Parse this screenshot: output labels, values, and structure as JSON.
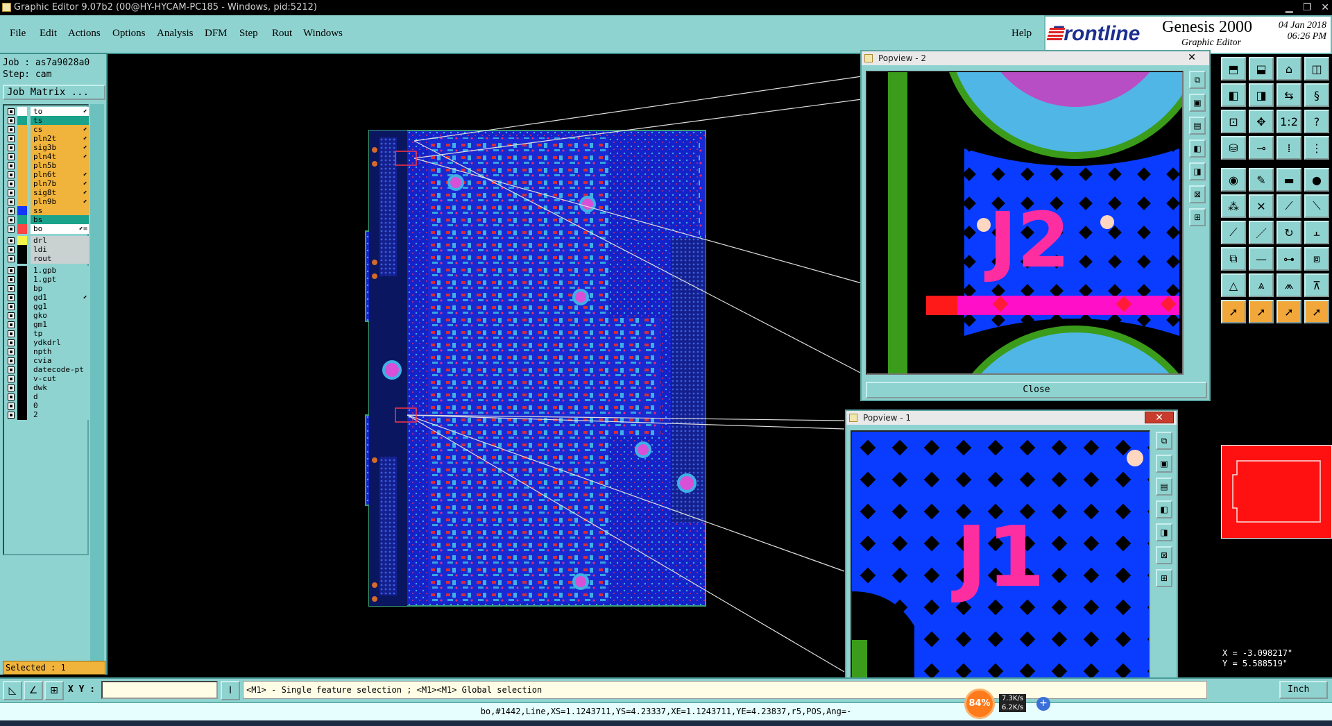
{
  "titlebar": {
    "title": "Graphic Editor 9.07b2 (00@HY-HYCAM-PC185 - Windows, pid:5212)",
    "minimize": "▁",
    "maximize": "❐",
    "close": "✕"
  },
  "menu": {
    "items": [
      "File",
      "Edit",
      "Actions",
      "Options",
      "Analysis",
      "DFM",
      "Step",
      "Rout",
      "Windows"
    ],
    "help": "Help"
  },
  "brand": {
    "logo": "Frontline",
    "product": "Genesis 2000",
    "subtitle": "Graphic Editor",
    "date": "04 Jan 2018",
    "time": "06:26 PM"
  },
  "job": {
    "job_line": "Job : as7a9028a0",
    "step_line": "Step: cam",
    "matrix_button": "Job Matrix ..."
  },
  "layers": [
    {
      "name": "to",
      "color": "#ffffff",
      "fill": "#ffffff",
      "arrow": "⬋"
    },
    {
      "name": "ts",
      "color": "#1aa38a",
      "fill": "#1aa38a",
      "arrow": ""
    },
    {
      "name": "cs",
      "color": "#f0b33c",
      "fill": "#f0b33c",
      "arrow": "⬋"
    },
    {
      "name": "pln2t",
      "color": "#f0b33c",
      "fill": "#f0b33c",
      "arrow": "⬋"
    },
    {
      "name": "sig3b",
      "color": "#f0b33c",
      "fill": "#f0b33c",
      "arrow": "⬋"
    },
    {
      "name": "pln4t",
      "color": "#f0b33c",
      "fill": "#f0b33c",
      "arrow": "⬋"
    },
    {
      "name": "pln5b",
      "color": "#f0b33c",
      "fill": "#f0b33c",
      "arrow": ""
    },
    {
      "name": "pln6t",
      "color": "#f0b33c",
      "fill": "#f0b33c",
      "arrow": "⬋"
    },
    {
      "name": "pln7b",
      "color": "#f0b33c",
      "fill": "#f0b33c",
      "arrow": "⬋"
    },
    {
      "name": "sig8t",
      "color": "#f0b33c",
      "fill": "#f0b33c",
      "arrow": "⬋"
    },
    {
      "name": "pln9b",
      "color": "#f0b33c",
      "fill": "#f0b33c",
      "arrow": "⬋"
    },
    {
      "name": "ss",
      "color": "#1436ff",
      "fill": "#f0b33c",
      "arrow": ""
    },
    {
      "name": "bs",
      "color": "#1aa38a",
      "fill": "#1aa38a",
      "arrow": ""
    },
    {
      "name": "bo",
      "color": "#ff4444",
      "fill": "#ffffff",
      "arrow": "⬋="
    },
    {
      "name": "drl",
      "color": "#f3f34a",
      "fill": "#c9d1d1",
      "arrow": ""
    },
    {
      "name": "ldi",
      "color": "#000000",
      "fill": "#c9d1d1",
      "arrow": ""
    },
    {
      "name": "rout",
      "color": "#000000",
      "fill": "#c9d1d1",
      "arrow": ""
    },
    {
      "name": "1.gpb",
      "color": "#000000",
      "fill": "#8fd3d0",
      "arrow": ""
    },
    {
      "name": "1.gpt",
      "color": "#000000",
      "fill": "#8fd3d0",
      "arrow": ""
    },
    {
      "name": "bp",
      "color": "#000000",
      "fill": "#8fd3d0",
      "arrow": ""
    },
    {
      "name": "gd1",
      "color": "#000000",
      "fill": "#8fd3d0",
      "arrow": "⬋"
    },
    {
      "name": "gg1",
      "color": "#000000",
      "fill": "#8fd3d0",
      "arrow": ""
    },
    {
      "name": "gko",
      "color": "#000000",
      "fill": "#8fd3d0",
      "arrow": ""
    },
    {
      "name": "gm1",
      "color": "#000000",
      "fill": "#8fd3d0",
      "arrow": ""
    },
    {
      "name": "tp",
      "color": "#000000",
      "fill": "#8fd3d0",
      "arrow": ""
    },
    {
      "name": "ydkdrl",
      "color": "#000000",
      "fill": "#8fd3d0",
      "arrow": ""
    },
    {
      "name": "npth",
      "color": "#000000",
      "fill": "#8fd3d0",
      "arrow": ""
    },
    {
      "name": "cvia",
      "color": "#000000",
      "fill": "#8fd3d0",
      "arrow": ""
    },
    {
      "name": "datecode-pt",
      "color": "#000000",
      "fill": "#8fd3d0",
      "arrow": ""
    },
    {
      "name": "v-cut",
      "color": "#000000",
      "fill": "#8fd3d0",
      "arrow": ""
    },
    {
      "name": "dwk",
      "color": "#000000",
      "fill": "#8fd3d0",
      "arrow": ""
    },
    {
      "name": "d",
      "color": "#000000",
      "fill": "#8fd3d0",
      "arrow": ""
    },
    {
      "name": "0",
      "color": "#000000",
      "fill": "#8fd3d0",
      "arrow": ""
    },
    {
      "name": "2",
      "color": "#000000",
      "fill": "#8fd3d0",
      "arrow": ""
    }
  ],
  "selected_text": "Selected : 1",
  "popview2": {
    "title": "Popview - 2",
    "close_x": "✕",
    "label": "J2",
    "close_button": "Close"
  },
  "popview1": {
    "title": "Popview - 1",
    "close_x": "✕",
    "label": "J1"
  },
  "coords": {
    "x": "X = -3.098217\"",
    "y": "Y =  5.588519\""
  },
  "bottom": {
    "xy_label": "X Y :",
    "xy_value": "",
    "hint": "<M1> - Single feature selection ; <M1><M1> Global selection",
    "unit": "Inch"
  },
  "status_line": "bo,#1442,Line,XS=1.1243711,YS=4.23337,XE=1.1243711,YE=4.23837,r5,POS,Ang=-",
  "netmeter": {
    "percent": "84%",
    "up": "7.3K/s",
    "down": "6.2K/s"
  }
}
